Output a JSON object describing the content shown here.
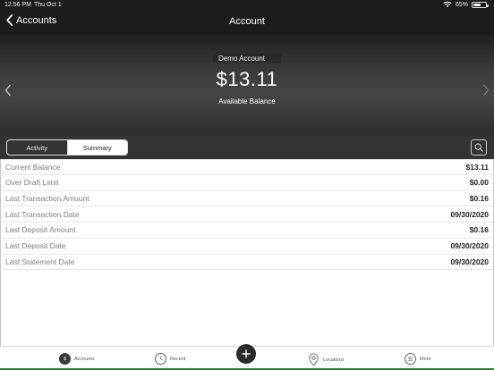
{
  "statusbar": {
    "time": "12:56 PM",
    "date": "Thu Oct 1",
    "battery": "65%",
    "battery_level": 0.65
  },
  "navbar": {
    "back_label": "Accounts",
    "title": "Account"
  },
  "hero": {
    "account_name": "Demo Account",
    "balance": "$13.11",
    "caption": "Available Balance"
  },
  "tabs": {
    "activity": "Activity",
    "summary": "Summary",
    "selected": "Summary"
  },
  "details": [
    {
      "label": "Current Balance",
      "value": "$13.11"
    },
    {
      "label": "Over Draft Limit",
      "value": "$0.00"
    },
    {
      "label": "Last Transaction Amount",
      "value": "$0.16"
    },
    {
      "label": "Last Transaction Date",
      "value": "09/30/2020"
    },
    {
      "label": "Last Deposit Amount",
      "value": "$0.16"
    },
    {
      "label": "Last Deposit Date",
      "value": "09/30/2020"
    },
    {
      "label": "Last Statement Date",
      "value": "09/30/2020"
    }
  ],
  "bottom_nav": {
    "accounts": "Accounts",
    "accounts_badge": "$",
    "recent": "Recent",
    "locations": "Locations",
    "more": "More"
  }
}
